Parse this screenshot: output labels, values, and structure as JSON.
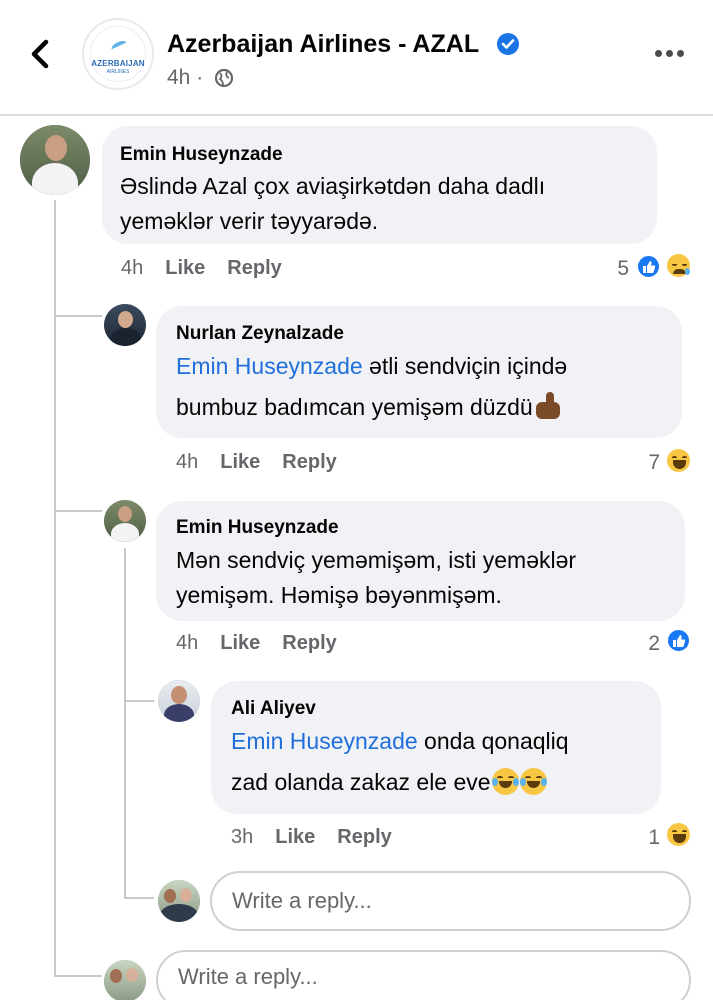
{
  "header": {
    "page_name": "Azerbaijan Airlines - AZAL",
    "logo_word": "AZERBAIJAN",
    "logo_sub": "AIRLINES",
    "post_age": "4h ·",
    "verified": true
  },
  "comments": [
    {
      "author": "Emin Huseynzade",
      "lines": [
        "Əslində Azal çox aviaşirkətdən daha dadlı",
        "yeməklər verir təyyarədə."
      ],
      "time": "4h",
      "like_label": "Like",
      "reply_label": "Reply",
      "reaction_count": "5",
      "reactions": [
        "like-icon",
        "sad-icon"
      ]
    },
    {
      "author": "Nurlan Zeynalzade",
      "mention": "Emin Huseynzade",
      "lines": [
        " ətli sendviçin içində",
        "bumbuz badımcan yemişəm düzdü"
      ],
      "time": "4h",
      "like_label": "Like",
      "reply_label": "Reply",
      "reaction_count": "7",
      "reactions": [
        "haha-icon"
      ]
    },
    {
      "author": "Emin Huseynzade",
      "lines": [
        "Mən sendviç yeməmişəm, isti yeməklər",
        "yemişəm. Həmişə bəyənmişəm."
      ],
      "time": "4h",
      "like_label": "Like",
      "reply_label": "Reply",
      "reaction_count": "2",
      "reactions": [
        "like-icon"
      ]
    },
    {
      "author": "Ali Aliyev",
      "mention": "Emin Huseynzade",
      "lines": [
        " onda qonaqliq",
        "zad olanda zakaz ele eve"
      ],
      "time": "3h",
      "like_label": "Like",
      "reply_label": "Reply",
      "reaction_count": "1",
      "reactions": [
        "haha-icon"
      ]
    }
  ],
  "reply_inputs": [
    {
      "placeholder": "Write a reply..."
    },
    {
      "placeholder": "Write a reply..."
    }
  ],
  "colors": {
    "accent": "#1877f2",
    "mention": "#216fdb",
    "bubble": "#f0f2f5",
    "secondary_text": "#65676b"
  }
}
